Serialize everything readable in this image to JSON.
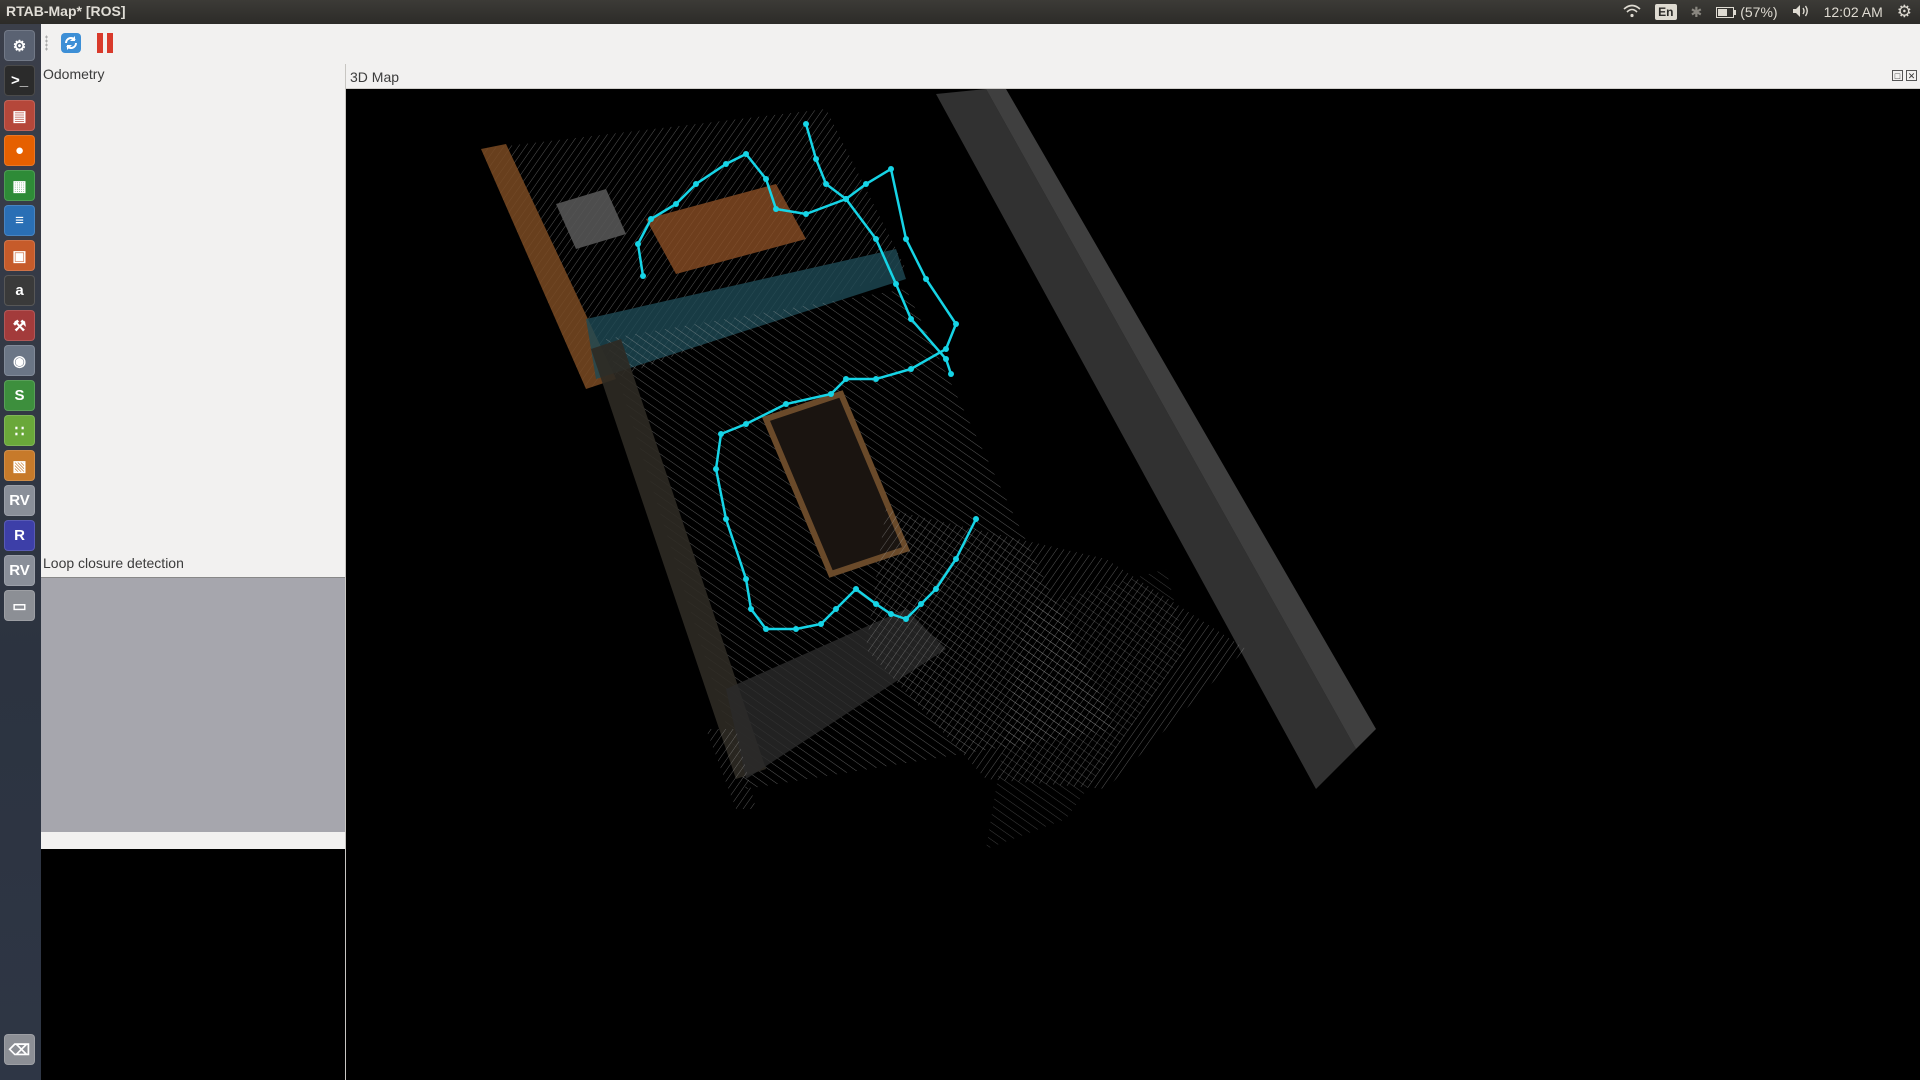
{
  "system": {
    "window_title": "RTAB-Map* [ROS]",
    "keyboard_layout": "En",
    "battery": "(57%)",
    "clock": "12:02 AM"
  },
  "launcher": {
    "items": [
      {
        "name": "system-settings-launcher",
        "icon": "gear-icon",
        "glyph": "⚙",
        "color": "#5a6272"
      },
      {
        "name": "terminal-launcher",
        "icon": "terminal-icon",
        "glyph": ">_",
        "color": "#2b2b2b"
      },
      {
        "name": "files-launcher",
        "icon": "folder-icon",
        "glyph": "▤",
        "color": "#b5473a"
      },
      {
        "name": "firefox-launcher",
        "icon": "firefox-icon",
        "glyph": "●",
        "color": "#e66000"
      },
      {
        "name": "calc-launcher",
        "icon": "spreadsheet-icon",
        "glyph": "▦",
        "color": "#2e8b37"
      },
      {
        "name": "writer-launcher",
        "icon": "document-icon",
        "glyph": "≡",
        "color": "#2a6fb5"
      },
      {
        "name": "impress-launcher",
        "icon": "presentation-icon",
        "glyph": "▣",
        "color": "#c65b2a"
      },
      {
        "name": "amazon-launcher",
        "icon": "amazon-icon",
        "glyph": "a",
        "color": "#3a3a3a"
      },
      {
        "name": "system-tools-launcher",
        "icon": "wrench-icon",
        "glyph": "⚒",
        "color": "#a33b3b"
      },
      {
        "name": "camera-launcher",
        "icon": "camera-icon",
        "glyph": "◉",
        "color": "#6b7686"
      },
      {
        "name": "slides-launcher",
        "icon": "s-app-icon",
        "glyph": "S",
        "color": "#3d8f3d"
      },
      {
        "name": "grid-app-launcher",
        "icon": "dots-grid-icon",
        "glyph": "∷",
        "color": "#6aa83a"
      },
      {
        "name": "package-launcher",
        "icon": "box-icon",
        "glyph": "▧",
        "color": "#c77a2a"
      },
      {
        "name": "rviz-launcher-1",
        "icon": "rviz-icon",
        "glyph": "RV",
        "color": "#8a8f99"
      },
      {
        "name": "rtabmap-launcher",
        "icon": "r-app-icon",
        "glyph": "R",
        "color": "#3d3fa8"
      },
      {
        "name": "rviz-launcher-2",
        "icon": "rviz-icon",
        "glyph": "RV",
        "color": "#8a8f99"
      },
      {
        "name": "drive-launcher",
        "icon": "drive-icon",
        "glyph": "▭",
        "color": "#8c8f95"
      }
    ],
    "trash": {
      "name": "trash-launcher",
      "icon": "trash-icon",
      "glyph": "⌫",
      "color": "#8c8f95"
    }
  },
  "toolbar": {
    "refresh_icon": "refresh-icon",
    "pause_icon": "pause-icon"
  },
  "panels": {
    "odometry_label": "Odometry",
    "loop_closure_label": "Loop closure detection",
    "map_title": "3D Map"
  },
  "colors": {
    "trajectory": "#16d4e6",
    "accent_orange": "#8a4e24",
    "map_background": "#000000"
  }
}
